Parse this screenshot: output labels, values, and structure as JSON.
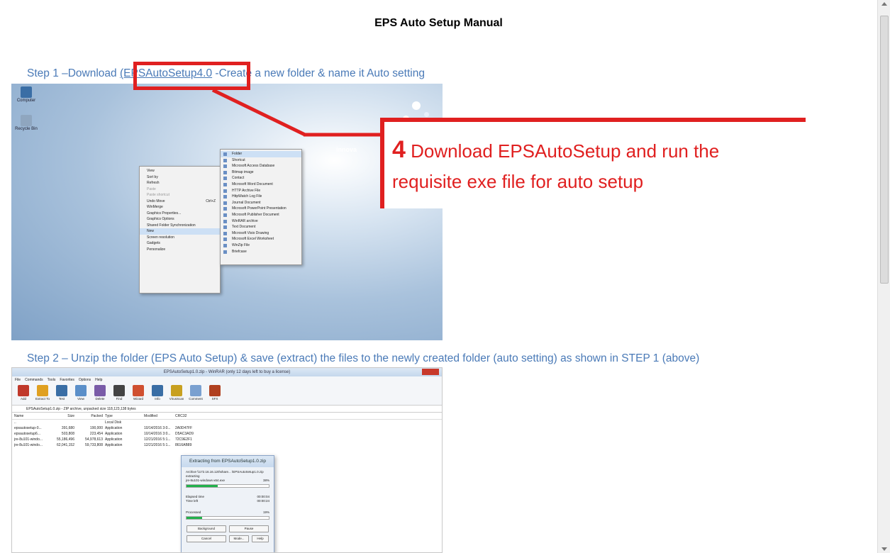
{
  "document": {
    "title": "EPS Auto Setup Manual",
    "step1": {
      "prefix": "Step 1 –Download ",
      "link_text": "(EPSAutoSetup4.0",
      "suffix": " -Create a new folder & name it Auto setting"
    },
    "step2": {
      "text": "Step 2 – Unzip the folder (EPS Auto Setup) & save (extract) the files to the newly created folder (auto setting) as shown in STEP 1 (above)"
    },
    "callout": {
      "number": "4",
      "line1": " Download EPSAutoSetup and run the",
      "line2": "requisite exe file for auto setup",
      "color": "#e02020"
    }
  },
  "screenshot1": {
    "desktop_icons": [
      "Computer",
      "Recycle Bin"
    ],
    "brand_text": "innova",
    "context_menu": [
      {
        "label": "View",
        "type": "normal"
      },
      {
        "label": "Sort by",
        "type": "normal"
      },
      {
        "label": "Refresh",
        "type": "normal"
      },
      {
        "label": "Paste",
        "type": "disabled"
      },
      {
        "label": "Paste shortcut",
        "type": "disabled"
      },
      {
        "label": "Undo Move",
        "type": "normal"
      },
      {
        "label": "WinMerge",
        "type": "normal"
      },
      {
        "label": "Graphics Properties...",
        "type": "normal"
      },
      {
        "label": "Graphics Options",
        "type": "normal"
      },
      {
        "label": "Shared Folder Synchronization",
        "type": "normal"
      },
      {
        "label": "New",
        "type": "highlight"
      },
      {
        "label": "Screen resolution",
        "type": "normal"
      },
      {
        "label": "Gadgets",
        "type": "normal"
      },
      {
        "label": "Personalize",
        "type": "normal"
      }
    ],
    "undo_shortcut": "Ctrl+Z",
    "new_submenu": [
      "Folder",
      "Shortcut",
      "Microsoft Access Database",
      "Bitmap image",
      "Contact",
      "Microsoft Word Document",
      "HTTP Archive File",
      "HttpWatch Log File",
      "Journal Document",
      "Microsoft PowerPoint Presentation",
      "Microsoft Publisher Document",
      "WinRAR archive",
      "Text Document",
      "Microsoft Visio Drawing",
      "Microsoft Excel Worksheet",
      "WinZip File",
      "Briefcase"
    ]
  },
  "screenshot2": {
    "window_title": "EPSAutoSetup1.0.zip - WinRAR (only 12 days left to buy a license)",
    "menu": [
      "File",
      "Commands",
      "Tools",
      "Favorites",
      "Options",
      "Help"
    ],
    "toolbar": [
      "Add",
      "Extract To",
      "Test",
      "View",
      "Delete",
      "Find",
      "Wizard",
      "Info",
      "VirusScan",
      "Comment",
      "SFX"
    ],
    "toolbar_colors": [
      "#c0392b",
      "#e0a020",
      "#3a6ea5",
      "#5b8fc9",
      "#7a5ca8",
      "#444",
      "#d05030",
      "#3a6ea5",
      "#c8a020",
      "#7aa0d0",
      "#b04020"
    ],
    "path": "EPSAutoSetup1.0.zip - ZIP archive, unpacked size 118,123,138 bytes",
    "columns": [
      "Name",
      "Size",
      "Packed",
      "Type",
      "Modified",
      "CRC32"
    ],
    "rows": [
      [
        "..",
        "",
        "",
        "Local Disk",
        "",
        ""
      ],
      [
        "epsautosetup-0...",
        "391,680",
        "190,000",
        "Application",
        "10/14/2016 3:0...",
        "2A0D47FF"
      ],
      [
        "epsautosetup6...",
        "503,808",
        "223,454",
        "Application",
        "10/14/2016 3:0...",
        "D5AC3AD9"
      ],
      [
        "jre-8u101-windo...",
        "55,186,496",
        "54,978,613",
        "Application",
        "12/21/2016 5:1...",
        "72C9E2F1"
      ],
      [
        "jre-8u101-windo...",
        "62,041,152",
        "59,733,808",
        "Application",
        "12/21/2016 5:1...",
        "8616AB89"
      ]
    ],
    "dialog": {
      "title": "Extracting from EPSAutoSetup1.0.zip",
      "archive": "Archive \\\\172.16.16.120\\share... \\EPSAutoSetup1.0.zip",
      "action": "extracting",
      "file": "jre-8u101-windows-x64.exe",
      "file_pct": "38%",
      "file_progress": 0.38,
      "elapsed_label": "Elapsed time",
      "elapsed": "00:00:04",
      "left_label": "Time left",
      "left": "00:00:24",
      "processed_label": "Processed",
      "processed_pct": "19%",
      "processed_progress": 0.19,
      "buttons": [
        "Background",
        "Pause",
        "Cancel",
        "Mode...",
        "Help"
      ]
    }
  }
}
